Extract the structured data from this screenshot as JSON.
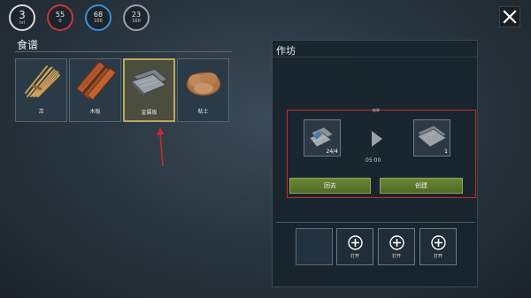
{
  "stats": {
    "level": {
      "value": "3",
      "label": "lvl"
    },
    "health": {
      "value": "55",
      "sub": "0"
    },
    "water": {
      "value": "68",
      "sub": "100"
    },
    "food": {
      "value": "23",
      "sub": "100"
    }
  },
  "recipes": {
    "title": "食谱",
    "items": [
      {
        "label": "苫"
      },
      {
        "label": "木板"
      },
      {
        "label": "金属板"
      },
      {
        "label": "粘土"
      }
    ]
  },
  "workshop": {
    "title": "作坊",
    "craft_label": "结果",
    "input_count": "24/4",
    "output_count": "1",
    "craft_time": "05:00",
    "back_label": "回去",
    "create_label": "创建",
    "tool_slots": [
      {
        "label": "打开"
      },
      {
        "label": "打开"
      },
      {
        "label": "打开"
      }
    ]
  },
  "colors": {
    "highlight": "#c92a2a",
    "button_green": "#5a7a2c",
    "selected_border": "#b9a85c"
  }
}
